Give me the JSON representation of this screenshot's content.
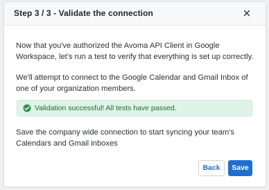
{
  "modal": {
    "title": "Step 3 / 3 - Validate the connection",
    "close_icon": "close-icon",
    "paragraph_1": "Now that you've authorized the Avoma API Client in Google Workspace, let's run a test to verify that everything is set up correctly.",
    "paragraph_2": "We'll attempt to connect to the Google Calendar and Gmail Inbox of one of your organization members.",
    "alert": {
      "icon": "check-circle-icon",
      "text": "Validation successful! All tests have passed.",
      "color": "#1e6b3a",
      "background": "#dff3e6"
    },
    "paragraph_3": "Save the company wide connection to start syncing your team's Calendars and Gmail inboxes",
    "buttons": {
      "back_label": "Back",
      "save_label": "Save"
    },
    "accent_color": "#1f6fd1"
  }
}
